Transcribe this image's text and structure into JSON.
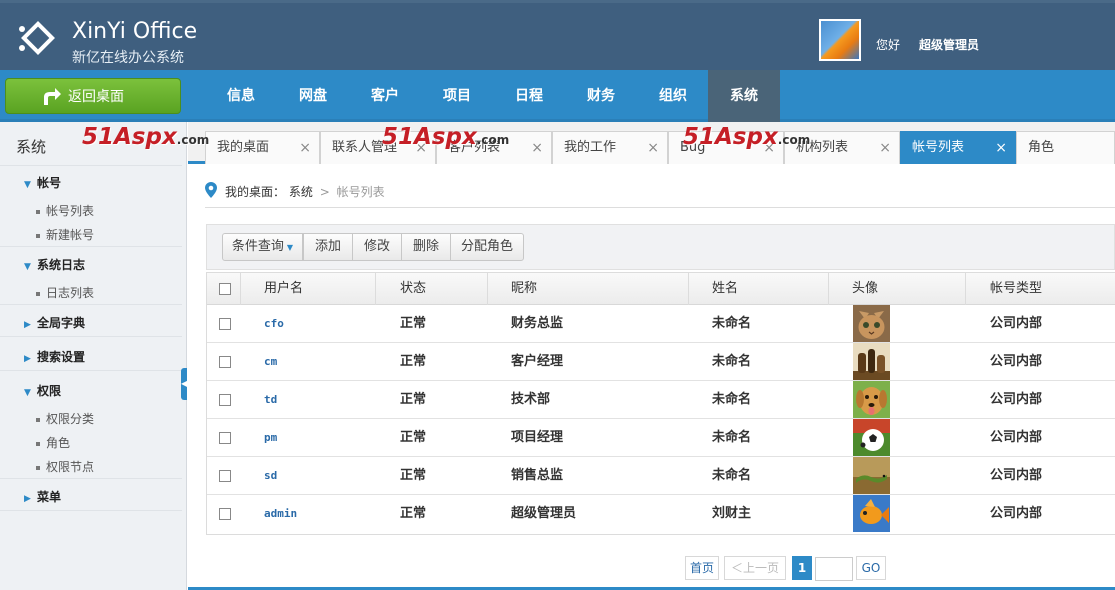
{
  "header": {
    "title": "XinYi Office",
    "subtitle": "新亿在线办公系统",
    "greeting": "您好",
    "username": "超级管理员"
  },
  "navbar": {
    "back_label": "返回桌面",
    "items": [
      "信息",
      "网盘",
      "客户",
      "项目",
      "日程",
      "财务",
      "组织",
      "系统"
    ],
    "active": "系统"
  },
  "sidebar": {
    "title": "系统",
    "groups": [
      {
        "label": "帐号",
        "expanded": true,
        "items": [
          "帐号列表",
          "新建帐号"
        ]
      },
      {
        "label": "系统日志",
        "expanded": true,
        "items": [
          "日志列表"
        ]
      },
      {
        "label": "全局字典",
        "expanded": false,
        "items": []
      },
      {
        "label": "搜索设置",
        "expanded": false,
        "items": []
      },
      {
        "label": "权限",
        "expanded": true,
        "items": [
          "权限分类",
          "角色",
          "权限节点"
        ]
      },
      {
        "label": "菜单",
        "expanded": false,
        "items": []
      }
    ]
  },
  "tabs": [
    {
      "label": "我的桌面",
      "active": false
    },
    {
      "label": "联系人管理",
      "active": false
    },
    {
      "label": "客户列表",
      "active": false
    },
    {
      "label": "我的工作",
      "active": false
    },
    {
      "label": "Bug",
      "active": false
    },
    {
      "label": "机构列表",
      "active": false
    },
    {
      "label": "帐号列表",
      "active": true
    },
    {
      "label": "角色",
      "active": false
    }
  ],
  "tab_close_glyph": "×",
  "watermark": {
    "text": "51Aspx",
    "suffix": ".com"
  },
  "breadcrumb": {
    "root": "我的桌面：",
    "parent": "系统",
    "separator": ">",
    "current": "帐号列表"
  },
  "toolbar": {
    "query_label": "条件查询",
    "add_label": "添加",
    "edit_label": "修改",
    "delete_label": "删除",
    "assign_role_label": "分配角色"
  },
  "table": {
    "columns": [
      "用户名",
      "状态",
      "昵称",
      "姓名",
      "头像",
      "帐号类型"
    ],
    "rows": [
      {
        "username": "cfo",
        "status": "正常",
        "nickname": "财务总监",
        "name": "未命名",
        "avatar": "cat-avatar",
        "type": "公司内部"
      },
      {
        "username": "cm",
        "status": "正常",
        "nickname": "客户经理",
        "name": "未命名",
        "avatar": "chess-avatar",
        "type": "公司内部"
      },
      {
        "username": "td",
        "status": "正常",
        "nickname": "技术部",
        "name": "未命名",
        "avatar": "dog-avatar",
        "type": "公司内部"
      },
      {
        "username": "pm",
        "status": "正常",
        "nickname": "项目经理",
        "name": "未命名",
        "avatar": "soccer-avatar",
        "type": "公司内部"
      },
      {
        "username": "sd",
        "status": "正常",
        "nickname": "销售总监",
        "name": "未命名",
        "avatar": "lizard-avatar",
        "type": "公司内部"
      },
      {
        "username": "admin",
        "status": "正常",
        "nickname": "超级管理员",
        "name": "刘财主",
        "avatar": "goldfish-avatar",
        "type": "公司内部"
      }
    ]
  },
  "pagination": {
    "first": "首页",
    "prev": "＜上一页",
    "current_page": "1",
    "go": "GO"
  },
  "colors": {
    "primary": "#2d8ac7",
    "header": "#3f5f7f",
    "back_button": "#6ab22e",
    "watermark": "#c51f26"
  }
}
